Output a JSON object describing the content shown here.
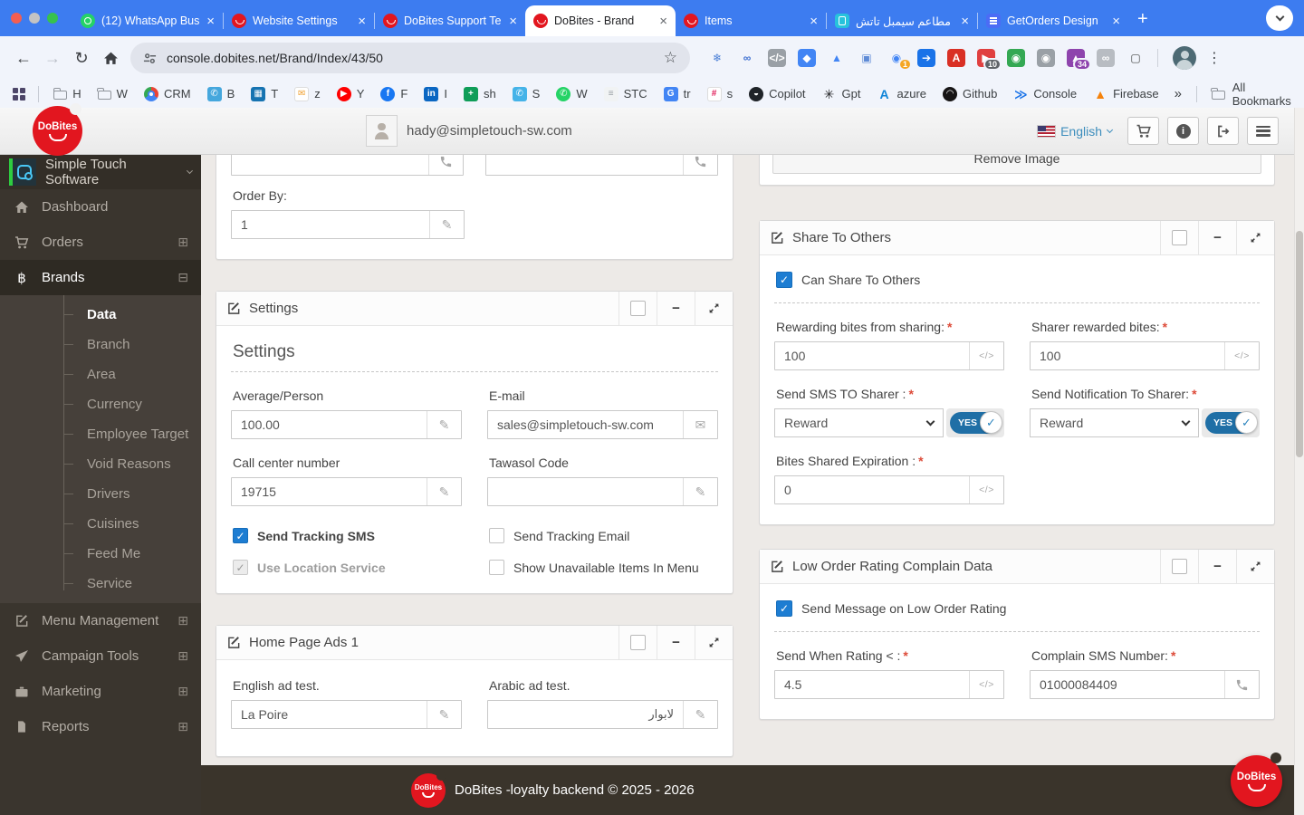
{
  "glyphs": {
    "back": "←",
    "forward": "→",
    "reload": "↻",
    "star": "☆",
    "kebab": "⋮",
    "new_tab": "+",
    "overflow": "»",
    "close": "×",
    "collapse": "−",
    "pencil": "✎",
    "envelope": "✉",
    "code": "</>",
    "expand_plus": "⊞",
    "expand_minus": "⊟"
  },
  "browser": {
    "tabs": [
      {
        "label": "(12) WhatsApp Bus",
        "icon": "whatsapp-favicon",
        "active": false
      },
      {
        "label": "Website Settings",
        "icon": "dobites-favicon",
        "active": false
      },
      {
        "label": "DoBites Support Te",
        "icon": "dobites-favicon",
        "active": false
      },
      {
        "label": "DoBites - Brand",
        "icon": "dobites-favicon",
        "active": true
      },
      {
        "label": "Items",
        "icon": "dobites-favicon",
        "active": false
      },
      {
        "label": "مطاعم سيمبل تاتش",
        "icon": "phone-favicon",
        "active": false
      },
      {
        "label": "GetOrders Design",
        "icon": "getorders-favicon",
        "active": false
      }
    ],
    "url": "console.dobites.net/Brand/Index/43/50",
    "extensions": [
      {
        "name": "snowflake-extension-icon",
        "glyph": "❄",
        "fg": "#4a7fd6",
        "bg": ""
      },
      {
        "name": "infinity-extension-icon",
        "glyph": "∞",
        "fg": "#3d6fd1",
        "bg": ""
      },
      {
        "name": "code-extension-icon",
        "glyph": "</>",
        "fg": "#ffffff",
        "bg": "#9aa0a6"
      },
      {
        "name": "tag-extension-icon",
        "glyph": "◆",
        "fg": "#ffffff",
        "bg": "#4285f4"
      },
      {
        "name": "google-ads-extension-icon",
        "glyph": "▲",
        "fg": "#4285f4",
        "bg": ""
      },
      {
        "name": "image-extension-icon",
        "glyph": "▣",
        "fg": "#5f8bd6",
        "bg": ""
      },
      {
        "name": "fingerprint-extension-icon",
        "glyph": "◉",
        "fg": "#4285f4",
        "bg": "",
        "badge": "1",
        "badge_bg": "#f5a623"
      },
      {
        "name": "share-extension-icon",
        "glyph": "➔",
        "fg": "#ffffff",
        "bg": "#1a73e8"
      },
      {
        "name": "adobe-pdf-extension-icon",
        "glyph": "A",
        "fg": "#ffffff",
        "bg": "#d93025"
      },
      {
        "name": "video-extension-icon",
        "glyph": "▶",
        "fg": "#ffffff",
        "bg": "#e04040",
        "badge": "10",
        "badge_bg": "#5f6368"
      },
      {
        "name": "robot-camera-extension-icon",
        "glyph": "◉",
        "fg": "#ffffff",
        "bg": "#34a853"
      },
      {
        "name": "camera-extension-icon",
        "glyph": "◉",
        "fg": "#ffffff",
        "bg": "#9aa0a6"
      },
      {
        "name": "hat-extension-icon",
        "glyph": "▲",
        "fg": "#ffffff",
        "bg": "#8e44ad",
        "badge": "34",
        "badge_bg": "#8e44ad"
      },
      {
        "name": "link-extension-icon",
        "glyph": "∞",
        "fg": "#ffffff",
        "bg": "#b8bcc2"
      },
      {
        "name": "clipboard-extension-icon",
        "glyph": "▢",
        "fg": "#444746",
        "bg": ""
      }
    ],
    "bookmarks": [
      {
        "label": "H",
        "kind": "folder"
      },
      {
        "label": "W",
        "kind": "folder"
      },
      {
        "label": "CRM",
        "kind": "chrome"
      },
      {
        "label": "B",
        "glyph": "✆",
        "fg": "#ffffff",
        "bg": "#45a7dd"
      },
      {
        "label": "T",
        "glyph": "▦",
        "fg": "#ffffff",
        "bg": "#1673b1"
      },
      {
        "label": "z",
        "glyph": "✉",
        "fg": "#f0a030",
        "bg": "#ffffff"
      },
      {
        "label": "Y",
        "glyph": "▶",
        "fg": "#ffffff",
        "bg": "#ff0000",
        "circle": true
      },
      {
        "label": "F",
        "glyph": "f",
        "fg": "#ffffff",
        "bg": "#1877f2",
        "circle": true
      },
      {
        "label": "I",
        "glyph": "in",
        "fg": "#ffffff",
        "bg": "#0a66c2"
      },
      {
        "label": "sh",
        "glyph": "+",
        "fg": "#ffffff",
        "bg": "#0f9d58"
      },
      {
        "label": "S",
        "glyph": "✆",
        "fg": "#ffffff",
        "bg": "#45b3e8"
      },
      {
        "label": "W",
        "glyph": "✆",
        "fg": "#ffffff",
        "bg": "#25d366",
        "circle": true
      },
      {
        "label": "STC",
        "glyph": "≡",
        "fg": "#9aa0a6",
        "bg": "#f1f3f4"
      },
      {
        "label": "tr",
        "glyph": "G",
        "fg": "#ffffff",
        "bg": "#4285f4"
      },
      {
        "label": "s",
        "glyph": "#",
        "fg": "#e01e5a",
        "bg": "#ffffff"
      },
      {
        "label": "Copilot",
        "glyph": "◒",
        "fg": "#ffffff",
        "bg": "#1f2328",
        "circle": true
      },
      {
        "label": "Gpt",
        "glyph": "✳",
        "fg": "#202123",
        "bg": ""
      },
      {
        "label": "azure",
        "glyph": "A",
        "fg": "#0f84d8",
        "bg": ""
      },
      {
        "label": "Github",
        "glyph": "◠",
        "fg": "#ffffff",
        "bg": "#171515",
        "circle": true
      },
      {
        "label": "Console",
        "glyph": "≫",
        "fg": "#1a73e8",
        "bg": ""
      },
      {
        "label": "Firebase",
        "glyph": "▲",
        "fg": "#f5820b",
        "bg": ""
      }
    ],
    "all_bookmarks_label": "All Bookmarks"
  },
  "app_header": {
    "logo_text": "DoBites",
    "user_email": "hady@simpletouch-sw.com",
    "language": "English"
  },
  "sidebar": {
    "brand_label": "Simple Touch Software",
    "items": [
      {
        "label": "Dashboard",
        "icon": "home-icon"
      },
      {
        "label": "Orders",
        "icon": "cart-icon",
        "expand": "plus"
      },
      {
        "label": "Brands",
        "icon": "brands-icon",
        "icon_glyph": "฿",
        "expand": "minus",
        "active": true,
        "children": [
          {
            "label": "Data",
            "active": true
          },
          {
            "label": "Branch"
          },
          {
            "label": "Area"
          },
          {
            "label": "Currency"
          },
          {
            "label": "Employee Target"
          },
          {
            "label": "Void Reasons"
          },
          {
            "label": "Drivers"
          },
          {
            "label": "Cuisines"
          },
          {
            "label": "Feed Me"
          },
          {
            "label": "Service"
          }
        ]
      },
      {
        "label": "Menu Management",
        "icon": "edit-icon",
        "expand": "plus"
      },
      {
        "label": "Campaign Tools",
        "icon": "send-icon",
        "expand": "plus"
      },
      {
        "label": "Marketing",
        "icon": "briefcase-icon",
        "expand": "plus"
      },
      {
        "label": "Reports",
        "icon": "file-icon",
        "expand": "plus"
      }
    ]
  },
  "main": {
    "contact_panel": {
      "order_by_label": "Order By:",
      "order_by_value": "1"
    },
    "settings_panel": {
      "title": "Settings",
      "section_title": "Settings",
      "average_person": {
        "label": "Average/Person",
        "value": "100.00"
      },
      "email": {
        "label": "E-mail",
        "value": "sales@simpletouch-sw.com"
      },
      "call_center": {
        "label": "Call center number",
        "value": "19715"
      },
      "tawasol": {
        "label": "Tawasol Code",
        "value": ""
      },
      "send_tracking_sms": {
        "label": "Send Tracking SMS",
        "checked": true
      },
      "send_tracking_email": {
        "label": "Send Tracking Email",
        "checked": false
      },
      "use_location_service": {
        "label": "Use Location Service",
        "checked": true,
        "disabled": true
      },
      "show_unavailable": {
        "label": "Show Unavailable Items In Menu",
        "checked": false
      }
    },
    "home_ads_panel": {
      "title": "Home Page Ads 1",
      "english_ad": {
        "label": "English ad test.",
        "value": "La Poire"
      },
      "arabic_ad": {
        "label": "Arabic ad test.",
        "value": "لابوار"
      }
    },
    "image_panel": {
      "remove_button": "Remove Image"
    },
    "share_panel": {
      "title": "Share To Others",
      "can_share_label": "Can Share To Others",
      "rewarding_bites": {
        "label": "Rewarding bites from sharing:",
        "value": "100",
        "required": "*"
      },
      "sharer_bites": {
        "label": "Sharer rewarded bites:",
        "value": "100",
        "required": "*"
      },
      "send_sms_sharer": {
        "label": "Send SMS TO Sharer :",
        "value": "Reward",
        "toggle": "YES",
        "required": "*"
      },
      "send_notification_sharer": {
        "label": "Send Notification To Sharer:",
        "value": "Reward",
        "toggle": "YES",
        "required": "*"
      },
      "bites_expiration": {
        "label": "Bites Shared Expiration :",
        "value": "0",
        "required": "*"
      }
    },
    "low_order_panel": {
      "title": "Low Order Rating Complain Data",
      "send_message_label": "Send Message on Low Order Rating",
      "rating_threshold": {
        "label": "Send When Rating < :",
        "value": "4.5",
        "required": "*"
      },
      "complain_sms": {
        "label": "Complain SMS Number:",
        "value": "01000084409",
        "required": "*"
      }
    }
  },
  "footer": {
    "text": "DoBites -loyalty backend © 2025 - 2026",
    "logo_text": "DoBites"
  }
}
